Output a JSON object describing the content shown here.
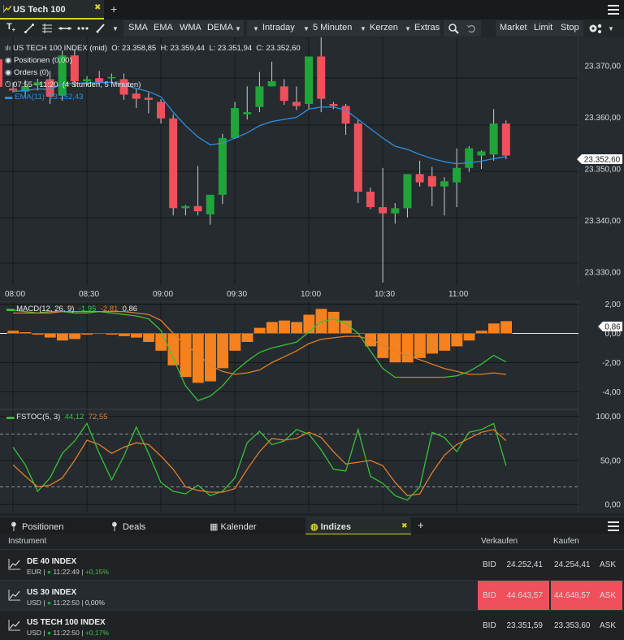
{
  "tab": {
    "title": "US Tech 100",
    "close": "✖",
    "plus": "+"
  },
  "toolbar": {
    "items": [
      "SMA",
      "EMA",
      "WMA",
      "DEMA"
    ],
    "interval": "Intraday",
    "resolution": "5 Minuten",
    "chart_style": "Kerzen",
    "extras": "Extras",
    "order_buttons": [
      "Market",
      "Limit",
      "Stop"
    ]
  },
  "chart_info": {
    "symbol_line": "US TECH 100 INDEX (mid)",
    "o": "O: 23.358,85",
    "h": "H: 23.359,44",
    "l": "L: 23.351,94",
    "c": "C: 23.352,60",
    "positions": "Positionen (0,00)",
    "orders": "Orders (0)",
    "timespan": "07:55 - 11:20",
    "timespan_detail": "(4 Stunden, 5 Minuten)",
    "ema_label": "EMA(11)",
    "ema_value": "23.352,43",
    "price_label": "23.352,60"
  },
  "macd": {
    "label": "MACD(12, 26, 9)",
    "v1": "-1,95",
    "v2": "-2,81",
    "v3": "0,86",
    "current": "0,86"
  },
  "fstoc": {
    "label": "FSTOC(5, 3)",
    "v1": "44,12",
    "v2": "72,55"
  },
  "colors": {
    "up": "#1fa53a",
    "down": "#f0505b",
    "ema": "#2e8fe0",
    "macd_bar": "#f5821f",
    "macd_line": "#37c23a",
    "signal_line": "#e07f2a",
    "accent": "#d9d02c"
  },
  "chart_data": [
    {
      "type": "candlestick",
      "x_ticks": [
        "08:00",
        "08:30",
        "09:00",
        "09:30",
        "10:00",
        "10:30",
        "11:00"
      ],
      "y_ticks": [
        "23.370,00",
        "23.360,00",
        "23.350,00",
        "23.340,00",
        "23.330,00"
      ],
      "ylim": [
        23327.5,
        23375.5
      ],
      "candles": [
        {
          "o": 23365.6,
          "h": 23366.8,
          "l": 23364.8,
          "c": 23365.2
        },
        {
          "o": 23365.0,
          "h": 23367.2,
          "l": 23363.8,
          "c": 23366.0
        },
        {
          "o": 23366.2,
          "h": 23367.5,
          "l": 23365.2,
          "c": 23366.8
        },
        {
          "o": 23367.4,
          "h": 23369.0,
          "l": 23362.6,
          "c": 23364.0
        },
        {
          "o": 23364.2,
          "h": 23373.0,
          "l": 23363.2,
          "c": 23372.0
        },
        {
          "o": 23372.0,
          "h": 23373.2,
          "l": 23366.0,
          "c": 23367.0
        },
        {
          "o": 23367.0,
          "h": 23368.0,
          "l": 23366.2,
          "c": 23367.4
        },
        {
          "o": 23367.6,
          "h": 23369.0,
          "l": 23366.2,
          "c": 23366.8
        },
        {
          "o": 23367.6,
          "h": 23368.5,
          "l": 23366.8,
          "c": 23367.8
        },
        {
          "o": 23367.4,
          "h": 23368.5,
          "l": 23363.4,
          "c": 23364.4
        },
        {
          "o": 23364.6,
          "h": 23365.6,
          "l": 23361.8,
          "c": 23363.6
        },
        {
          "o": 23363.8,
          "h": 23364.8,
          "l": 23360.8,
          "c": 23363.4
        },
        {
          "o": 23363.0,
          "h": 23363.5,
          "l": 23358.8,
          "c": 23359.8
        },
        {
          "o": 23359.8,
          "h": 23360.6,
          "l": 23341.0,
          "c": 23342.4
        },
        {
          "o": 23342.4,
          "h": 23343.0,
          "l": 23341.0,
          "c": 23342.8
        },
        {
          "o": 23342.8,
          "h": 23350.6,
          "l": 23341.0,
          "c": 23341.8
        },
        {
          "o": 23341.2,
          "h": 23343.6,
          "l": 23339.2,
          "c": 23345.0
        },
        {
          "o": 23345.0,
          "h": 23356.8,
          "l": 23343.2,
          "c": 23356.0
        },
        {
          "o": 23356.0,
          "h": 23363.0,
          "l": 23355.8,
          "c": 23361.8
        },
        {
          "o": 23360.6,
          "h": 23366.0,
          "l": 23359.6,
          "c": 23361.0
        },
        {
          "o": 23362.0,
          "h": 23368.8,
          "l": 23361.0,
          "c": 23366.0
        },
        {
          "o": 23366.0,
          "h": 23370.8,
          "l": 23366.0,
          "c": 23367.0
        },
        {
          "o": 23366.0,
          "h": 23367.4,
          "l": 23362.4,
          "c": 23363.2
        },
        {
          "o": 23363.0,
          "h": 23366.0,
          "l": 23361.4,
          "c": 23362.2
        },
        {
          "o": 23362.6,
          "h": 23370.6,
          "l": 23361.6,
          "c": 23371.8
        },
        {
          "o": 23371.8,
          "h": 23376.0,
          "l": 23361.0,
          "c": 23363.6
        },
        {
          "o": 23362.6,
          "h": 23363.0,
          "l": 23361.6,
          "c": 23362.2
        },
        {
          "o": 23362.2,
          "h": 23362.6,
          "l": 23356.6,
          "c": 23358.8
        },
        {
          "o": 23358.8,
          "h": 23359.6,
          "l": 23343.4,
          "c": 23345.6
        },
        {
          "o": 23345.6,
          "h": 23346.4,
          "l": 23342.2,
          "c": 23342.6
        },
        {
          "o": 23342.6,
          "h": 23350.2,
          "l": 23328.0,
          "c": 23341.4
        },
        {
          "o": 23341.4,
          "h": 23343.4,
          "l": 23339.4,
          "c": 23342.4
        },
        {
          "o": 23342.4,
          "h": 23348.2,
          "l": 23340.6,
          "c": 23349.0
        },
        {
          "o": 23349.0,
          "h": 23351.6,
          "l": 23346.6,
          "c": 23347.4
        },
        {
          "o": 23348.6,
          "h": 23350.4,
          "l": 23342.8,
          "c": 23346.6
        },
        {
          "o": 23346.6,
          "h": 23348.4,
          "l": 23341.0,
          "c": 23347.6
        },
        {
          "o": 23347.4,
          "h": 23354.0,
          "l": 23342.6,
          "c": 23350.2
        },
        {
          "o": 23350.2,
          "h": 23354.4,
          "l": 23349.4,
          "c": 23354.0
        },
        {
          "o": 23352.6,
          "h": 23353.6,
          "l": 23350.0,
          "c": 23353.4
        },
        {
          "o": 23352.8,
          "h": 23361.6,
          "l": 23351.6,
          "c": 23358.8
        },
        {
          "o": 23358.8,
          "h": 23359.4,
          "l": 23351.9,
          "c": 23352.6
        }
      ],
      "ema": [
        23365.0,
        23365.2,
        23365.5,
        23365.4,
        23366.5,
        23366.6,
        23366.7,
        23366.7,
        23366.8,
        23366.3,
        23365.6,
        23365.0,
        23364.0,
        23361.0,
        23358.4,
        23356.2,
        23354.7,
        23355.0,
        23356.0,
        23357.0,
        23358.4,
        23359.2,
        23359.6,
        23360.0,
        23361.6,
        23362.0,
        23362.0,
        23361.4,
        23359.6,
        23357.8,
        23356.0,
        23354.4,
        23353.8,
        23352.8,
        23352.0,
        23351.4,
        23351.0,
        23351.2,
        23351.5,
        23352.0,
        23352.4
      ]
    },
    {
      "type": "bar",
      "name": "MACD(12, 26, 9)",
      "y_ticks": [
        "2,00",
        "0,00",
        "-2,00",
        "-4,00"
      ],
      "ylim": [
        -5.2,
        2.2
      ],
      "histogram": [
        0.2,
        0.1,
        -0.1,
        -0.3,
        -0.5,
        -0.4,
        -0.1,
        0.0,
        -0.1,
        -0.2,
        -0.3,
        -0.6,
        -1.2,
        -2.2,
        -3.0,
        -3.4,
        -3.3,
        -2.4,
        -1.2,
        -0.6,
        0.4,
        0.8,
        0.9,
        0.8,
        1.3,
        1.7,
        1.5,
        0.9,
        0.0,
        -0.9,
        -1.7,
        -2.0,
        -2.0,
        -1.7,
        -1.4,
        -1.2,
        -0.9,
        -0.5,
        0.2,
        0.7,
        0.86
      ],
      "macd_line": [
        1.6,
        1.5,
        1.4,
        1.5,
        1.5,
        1.4,
        1.4,
        1.5,
        1.4,
        1.3,
        1.2,
        1.0,
        0.2,
        -1.7,
        -3.6,
        -4.6,
        -4.3,
        -3.6,
        -2.6,
        -1.9,
        -1.3,
        -1.0,
        -0.8,
        -0.6,
        0.1,
        0.8,
        1.0,
        0.7,
        0.0,
        -1.2,
        -2.4,
        -3.0,
        -3.0,
        -3.0,
        -3.0,
        -3.0,
        -2.9,
        -2.6,
        -2.1,
        -1.5,
        -1.95
      ],
      "signal_line": [
        1.4,
        1.4,
        1.4,
        1.4,
        1.5,
        1.5,
        1.5,
        1.5,
        1.5,
        1.5,
        1.4,
        1.3,
        0.9,
        0.0,
        -0.8,
        -1.4,
        -2.2,
        -2.6,
        -2.8,
        -2.7,
        -2.5,
        -2.0,
        -1.6,
        -1.2,
        -0.7,
        -0.4,
        -0.3,
        -0.2,
        -0.2,
        -0.4,
        -0.8,
        -1.2,
        -1.5,
        -1.8,
        -2.1,
        -2.4,
        -2.6,
        -2.8,
        -2.8,
        -2.7,
        -2.81
      ]
    },
    {
      "type": "line",
      "name": "FSTOC(5, 3)",
      "y_ticks": [
        "100,00",
        "50,00",
        "0,00"
      ],
      "ylim": [
        -10,
        108
      ],
      "overbought": 80,
      "oversold": 20,
      "k_line": [
        65,
        45,
        15,
        30,
        58,
        72,
        92,
        58,
        28,
        55,
        88,
        58,
        25,
        15,
        12,
        22,
        10,
        15,
        30,
        70,
        83,
        68,
        72,
        85,
        80,
        62,
        40,
        38,
        85,
        32,
        24,
        10,
        5,
        20,
        82,
        76,
        60,
        82,
        85,
        92,
        44.12
      ],
      "d_line": [
        45,
        32,
        20,
        22,
        30,
        50,
        73,
        68,
        58,
        65,
        70,
        68,
        55,
        40,
        20,
        16,
        14,
        14,
        18,
        40,
        60,
        75,
        73,
        75,
        82,
        76,
        60,
        46,
        48,
        50,
        44,
        25,
        10,
        12,
        36,
        56,
        68,
        75,
        82,
        85,
        72.55
      ]
    }
  ],
  "bottom_tabs": [
    {
      "label": "Positionen"
    },
    {
      "label": "Deals"
    },
    {
      "label": "Kalender"
    },
    {
      "label": "Indizes"
    }
  ],
  "bottom_tab_close": "✖",
  "bottom_tab_plus": "+",
  "table": {
    "headers": {
      "instrument": "Instrument",
      "sell": "Verkaufen",
      "buy": "Kaufen"
    },
    "rows": [
      {
        "name": "DE 40 INDEX",
        "currency": "EUR",
        "time": "11:22:49",
        "change": "+0,15%",
        "bid_label": "BID",
        "bid": "24.252,41",
        "ask": "24.254,41",
        "ask_label": "ASK",
        "highlight": false
      },
      {
        "name": "US 30 INDEX",
        "currency": "USD",
        "time": "11:22:50",
        "change": "0,00%",
        "bid_label": "BID",
        "bid": "44.643,57",
        "ask": "44.648,57",
        "ask_label": "ASK",
        "highlight": true
      },
      {
        "name": "US TECH 100 INDEX",
        "currency": "USD",
        "time": "11:22:50",
        "change": "+0,17%",
        "bid_label": "BID",
        "bid": "23.351,59",
        "ask": "23.353,60",
        "ask_label": "ASK",
        "highlight": false
      }
    ]
  }
}
